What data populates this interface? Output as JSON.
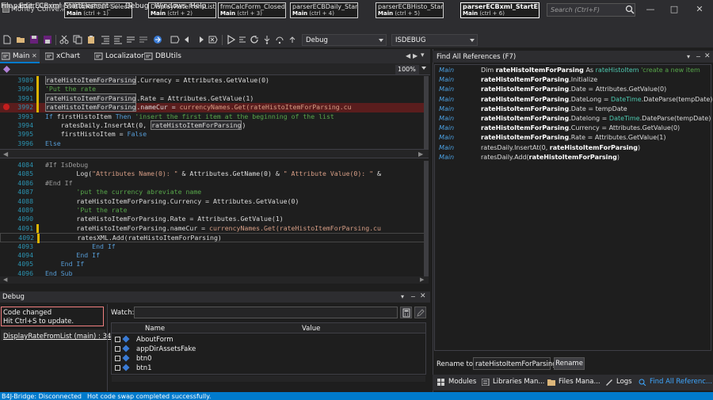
{
  "window": {
    "title": "Money Conve...",
    "search_placeholder": "Search (Ctrl+F)"
  },
  "doc_tabs": [
    {
      "title": "chBoxRefCur_SelectedInd",
      "module": "Main",
      "shortcut": "(ctrl + 1)"
    },
    {
      "title": "DisplayRateFromList",
      "module": "Main",
      "shortcut": "(ctrl + 2)"
    },
    {
      "title": "frmCalcForm_Closed",
      "module": "Main",
      "shortcut": "(ctrl + 3)"
    },
    {
      "title": "parserECBDaily_StartElem",
      "module": "Main",
      "shortcut": "(ctrl + 4)"
    },
    {
      "title": "parserECBHisto_StartElem",
      "module": "Main",
      "shortcut": "(ctrl + 5)"
    },
    {
      "title": "parserECBxml_StartElement",
      "module": "Main",
      "shortcut": "(ctrl + 6)"
    }
  ],
  "menu": [
    "File",
    "Edit",
    "Designer",
    "Project",
    "Tools",
    "Debug",
    "Windows",
    "Help"
  ],
  "toolbar": {
    "config": "Debug",
    "symbol": "ISDEBUG"
  },
  "tool_tabs": [
    "Main",
    "xChart",
    "Localizator",
    "DBUtils"
  ],
  "nav": {
    "sub": "parserECBxml_StartElement",
    "zoom": "100%"
  },
  "editor_top": [
    {
      "n": "3989",
      "segs": [
        [
          "v",
          "rateHistoItemForParsing"
        ],
        [
          "p",
          ".Currency = Attributes.GetValue(0)"
        ]
      ]
    },
    {
      "n": "3990",
      "segs": [
        [
          "c",
          "'Put the rate"
        ]
      ]
    },
    {
      "n": "3991",
      "segs": [
        [
          "v",
          "rateHistoItemForParsing"
        ],
        [
          "p",
          ".Rate = Attributes.GetValue(1)"
        ]
      ]
    },
    {
      "n": "3992",
      "segs": [
        [
          "v",
          "rateHistoItemForParsing"
        ],
        [
          "p",
          ".nameCur = "
        ],
        [
          "s",
          "currencyNames.Get(rateHistoItemForParsing.cu"
        ]
      ]
    },
    {
      "n": "3993",
      "segs": [
        [
          "k",
          "If "
        ],
        [
          "p",
          "firstHistoItem "
        ],
        [
          "k",
          "Then "
        ],
        [
          "c",
          "'insert the first item at the beginning of the list"
        ]
      ]
    },
    {
      "n": "3994",
      "segs": [
        [
          "p",
          "    ratesDaily.InsertAt(0, "
        ],
        [
          "v",
          "rateHistoItemForParsing"
        ],
        [
          "p",
          ")"
        ]
      ]
    },
    {
      "n": "3995",
      "segs": [
        [
          "p",
          "    firstHistoItem = "
        ],
        [
          "k",
          "False"
        ]
      ]
    },
    {
      "n": "3996",
      "segs": [
        [
          "k",
          "Else"
        ]
      ]
    }
  ],
  "editor_bottom": [
    {
      "n": "4084",
      "segs": [
        [
          "d",
          "#If IsDebug"
        ]
      ]
    },
    {
      "n": "4085",
      "segs": [
        [
          "p",
          "        Log("
        ],
        [
          "s",
          "\"Attributes Name(0): \""
        ],
        [
          "p",
          " & Attributes.GetName(0) & "
        ],
        [
          "s",
          "\" Attribute Value(0): \""
        ],
        [
          "p",
          " &"
        ]
      ]
    },
    {
      "n": "4086",
      "segs": [
        [
          "d",
          "#End If"
        ]
      ]
    },
    {
      "n": "4087",
      "segs": [
        [
          "c",
          "        'put the currency abreviate name"
        ]
      ]
    },
    {
      "n": "4088",
      "segs": [
        [
          "p",
          "        rateHistoItemForParsing.Currency = Attributes.GetValue(0)"
        ]
      ]
    },
    {
      "n": "4089",
      "segs": [
        [
          "c",
          "        'Put the rate"
        ]
      ]
    },
    {
      "n": "4090",
      "segs": [
        [
          "p",
          "        rateHistoItemForParsing.Rate = Attributes.GetValue(1)"
        ]
      ]
    },
    {
      "n": "4091",
      "segs": [
        [
          "p",
          "        rateHistoItemForParsing.nameCur = "
        ],
        [
          "s",
          "currencyNames.Get(rateHistoItemForParsing.cu"
        ]
      ]
    },
    {
      "n": "4092",
      "segs": [
        [
          "p",
          "        ratesXML.Add(rateHistoItemForParsing)"
        ]
      ]
    },
    {
      "n": "4093",
      "segs": [
        [
          "k",
          "            End If"
        ]
      ]
    },
    {
      "n": "4094",
      "segs": [
        [
          "k",
          "        End If"
        ]
      ]
    },
    {
      "n": "4095",
      "segs": [
        [
          "k",
          "    End If"
        ]
      ]
    },
    {
      "n": "4096",
      "segs": [
        [
          "k",
          "End Sub"
        ]
      ]
    }
  ],
  "debug": {
    "title": "Debug",
    "notice_line1": "Code changed",
    "notice_line2": "Hit Ctrl+S to update.",
    "stack_item": "DisplayRateFromList (main) : 3400",
    "watch_label": "Watch:",
    "col_name": "Name",
    "col_value": "Value",
    "vars": [
      "AboutForm",
      "appDirAssetsFake",
      "btn0",
      "btn1"
    ]
  },
  "status": {
    "bridge": "B4J-Bridge: Disconnected",
    "message": "Hot code swap completed successfully."
  },
  "find_refs": {
    "title": "Find All References (F7)",
    "rows": [
      {
        "ctx": "Main",
        "code": [
          [
            "n",
            "Dim "
          ],
          [
            "b",
            "rateHistoItemForParsing"
          ],
          [
            "n",
            " As "
          ],
          [
            "t",
            "rateHistoItem"
          ],
          [
            "c",
            " 'create a new item"
          ]
        ]
      },
      {
        "ctx": "Main",
        "code": [
          [
            "b",
            "rateHistoItemForParsing"
          ],
          [
            "n",
            ".Initialize"
          ]
        ]
      },
      {
        "ctx": "Main",
        "code": [
          [
            "b",
            "rateHistoItemForParsing"
          ],
          [
            "n",
            ".Date = Attributes.GetValue(0)"
          ]
        ]
      },
      {
        "ctx": "Main",
        "code": [
          [
            "b",
            "rateHistoItemForParsing"
          ],
          [
            "n",
            ".DateLong = "
          ],
          [
            "t",
            "DateTime"
          ],
          [
            "n",
            ".DateParse(tempDate)"
          ]
        ]
      },
      {
        "ctx": "Main",
        "code": [
          [
            "b",
            "rateHistoItemForParsing"
          ],
          [
            "n",
            ".Date = tempDate"
          ]
        ]
      },
      {
        "ctx": "Main",
        "code": [
          [
            "b",
            "rateHistoItemForParsing"
          ],
          [
            "n",
            ".Datelong = "
          ],
          [
            "t",
            "DateTime"
          ],
          [
            "n",
            ".DateParse(tempDate)"
          ]
        ]
      },
      {
        "ctx": "Main",
        "code": [
          [
            "b",
            "rateHistoItemForParsing"
          ],
          [
            "n",
            ".Currency = Attributes.GetValue(0)"
          ]
        ]
      },
      {
        "ctx": "Main",
        "code": [
          [
            "b",
            "rateHistoItemForParsing"
          ],
          [
            "n",
            ".Rate = Attributes.GetValue(1)"
          ]
        ]
      },
      {
        "ctx": "Main",
        "code": [
          [
            "n",
            "ratesDaily.InsertAt(0, "
          ],
          [
            "b",
            "rateHistoItemForParsing"
          ],
          [
            "n",
            ")"
          ]
        ]
      },
      {
        "ctx": "Main",
        "code": [
          [
            "n",
            "ratesDaily.Add("
          ],
          [
            "b",
            "rateHistoItemForParsing"
          ],
          [
            "n",
            ")"
          ]
        ]
      }
    ],
    "rename_label": "Rename to:",
    "rename_value": "rateHistoItemForParsing",
    "rename_button": "Rename"
  },
  "bottom_tabs": [
    "Modules",
    "Libraries Man...",
    "Files Mana...",
    "Logs",
    "Find All Referenc..."
  ],
  "colors": {
    "accent": "#007acc",
    "breakpoint": "#c41e1e",
    "notice_border": "#f08080"
  }
}
